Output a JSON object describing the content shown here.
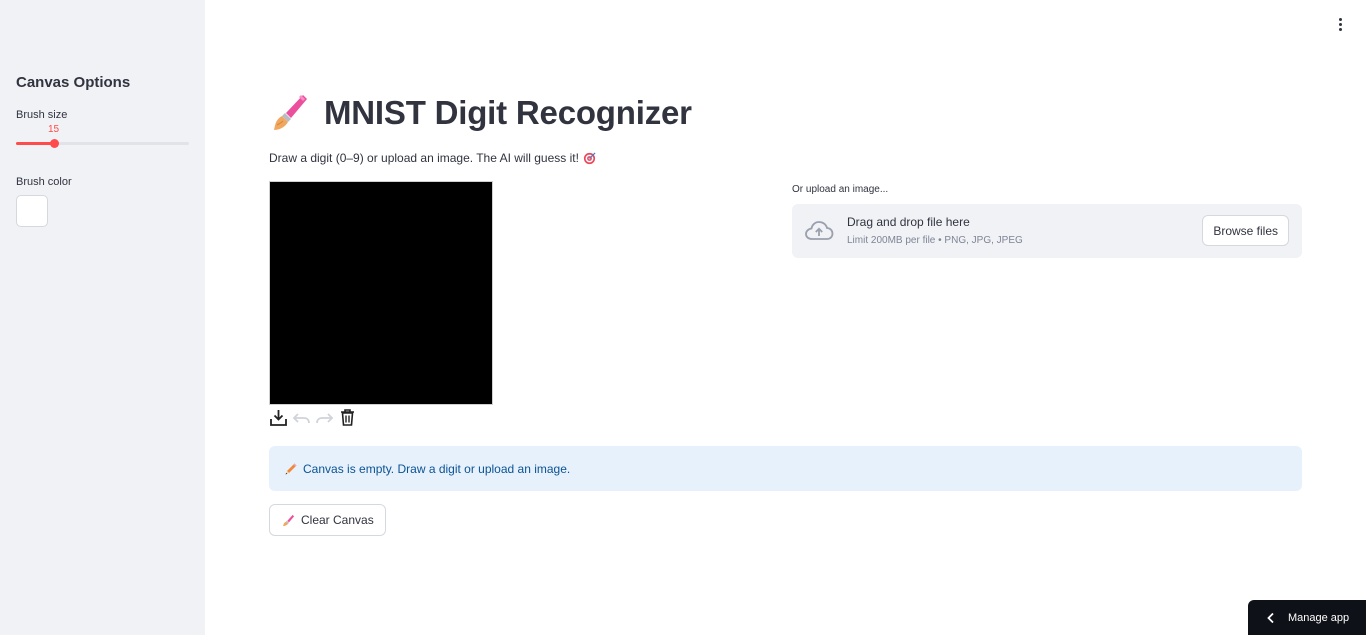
{
  "sidebar": {
    "title": "Canvas Options",
    "brush_size": {
      "label": "Brush size",
      "value": "15",
      "min": 1,
      "max": 70,
      "fraction": 0.22
    },
    "brush_color": {
      "label": "Brush color",
      "value": "#FFFFFF"
    }
  },
  "main": {
    "title": "MNIST Digit Recognizer",
    "subtitle": "Draw a digit (0–9) or upload an image. The AI will guess it!",
    "canvas_background": "#000000",
    "upload": {
      "label": "Or upload an image...",
      "drop_text": "Drag and drop file here",
      "limit_text": "Limit 200MB per file • PNG, JPG, JPEG",
      "browse_label": "Browse files"
    },
    "info_message": "Canvas is empty. Draw a digit or upload an image.",
    "clear_button": "Clear Canvas"
  },
  "footer": {
    "manage_app": "Manage app"
  },
  "colors": {
    "accent": "#FF4B4B",
    "sidebar_bg": "#F0F2F6",
    "info_bg": "#E6F1FC",
    "info_text": "#0B5394"
  },
  "icons": [
    "paintbrush-icon",
    "target-icon",
    "download-icon",
    "undo-icon",
    "redo-icon",
    "trash-icon",
    "cloud-upload-icon",
    "pencil-icon",
    "kebab-menu-icon",
    "chevron-left-icon"
  ]
}
